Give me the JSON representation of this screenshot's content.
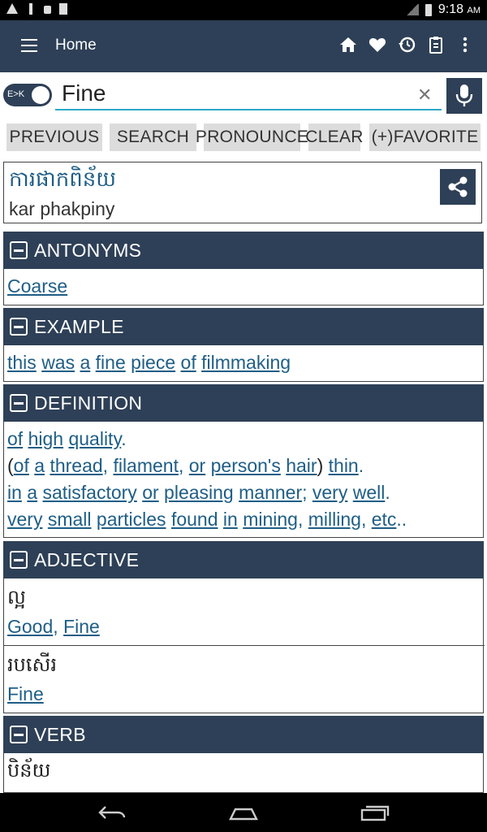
{
  "status_bar": {
    "time": "9:18",
    "ampm": "AM"
  },
  "app_bar": {
    "title": "Home"
  },
  "search": {
    "toggle_label": "E>K",
    "query": "Fine"
  },
  "buttons": {
    "previous": "PREVIOUS",
    "search": "SEARCH",
    "pronounce": "PRONOUNCE",
    "clear": "CLEAR",
    "favorite": "(+)FAVORITE"
  },
  "entry": {
    "khmer": "ការផាកពិន័យ",
    "transliteration": "kar phakpiny"
  },
  "sections": {
    "antonyms": {
      "title": "ANTONYMS",
      "words": [
        "Coarse"
      ]
    },
    "example": {
      "title": "EXAMPLE",
      "words": [
        "this",
        "was",
        "a",
        "fine",
        "piece",
        "of",
        "filmmaking"
      ]
    },
    "definition": {
      "title": "DEFINITION",
      "line1": [
        "of",
        "high",
        "quality",
        "."
      ],
      "line2": [
        "(",
        "of",
        "a",
        "thread",
        ",",
        "filament",
        ",",
        "or",
        "person's",
        "hair",
        ")",
        "thin",
        "."
      ],
      "line3": [
        "in",
        "a",
        "satisfactory",
        "or",
        "pleasing",
        "manner",
        ";",
        "very",
        "well",
        "."
      ],
      "line4": [
        "very",
        "small",
        "particles",
        "found",
        "in",
        "mining",
        ",",
        "milling",
        ",",
        "etc",
        ".."
      ]
    },
    "adjective": {
      "title": "ADJECTIVE",
      "khmer1": "ល្អ",
      "gloss1": [
        "Good",
        ",",
        "Fine"
      ],
      "khmer2": "របសើរ",
      "gloss2": [
        "Fine"
      ]
    },
    "verb": {
      "title": "VERB",
      "khmer1": "បិន័យ"
    }
  },
  "colors": {
    "primary": "#2e4057",
    "link": "#1f5e86",
    "accent": "#2aa9c5",
    "button_bg": "#dcdcdc"
  }
}
